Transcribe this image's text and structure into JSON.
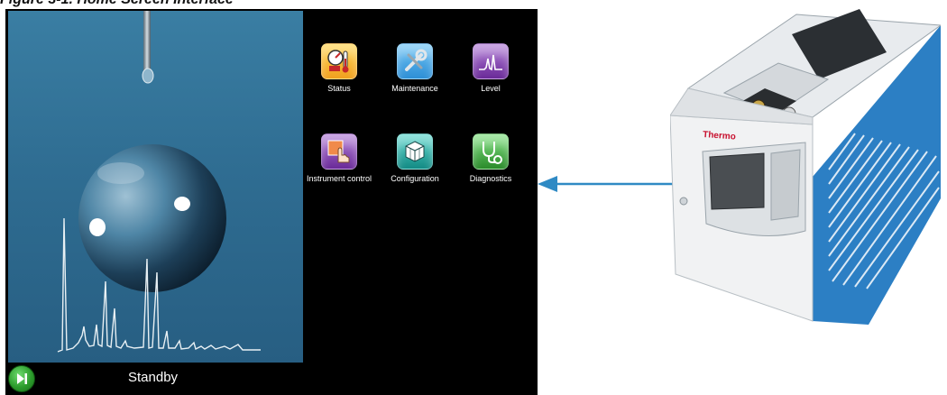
{
  "figure_caption": "Figure 3-1. Home Screen Interface",
  "apps": [
    {
      "label": "Status",
      "icon": "status-gauge-thermometer-icon",
      "color": "#f0a020"
    },
    {
      "label": "Maintenance",
      "icon": "maintenance-wrench-icon",
      "color": "#2e8fd6"
    },
    {
      "label": "Level",
      "icon": "level-peaks-icon",
      "color": "#7a3aa8"
    },
    {
      "label": "Instrument control",
      "icon": "instrument-control-hand-icon",
      "color": "#8a4aa8"
    },
    {
      "label": "Configuration",
      "icon": "configuration-cube-icon",
      "color": "#1aa8a0"
    },
    {
      "label": "Diagnostics",
      "icon": "diagnostics-stethoscope-icon",
      "color": "#3aaa3a"
    }
  ],
  "status_bar": {
    "status_text": "Standby",
    "run_button_icon": "run-next-icon"
  },
  "instrument": {
    "brand": "Thermo",
    "brand_color": "#c8102e",
    "accent_color": "#2c7fc4"
  }
}
